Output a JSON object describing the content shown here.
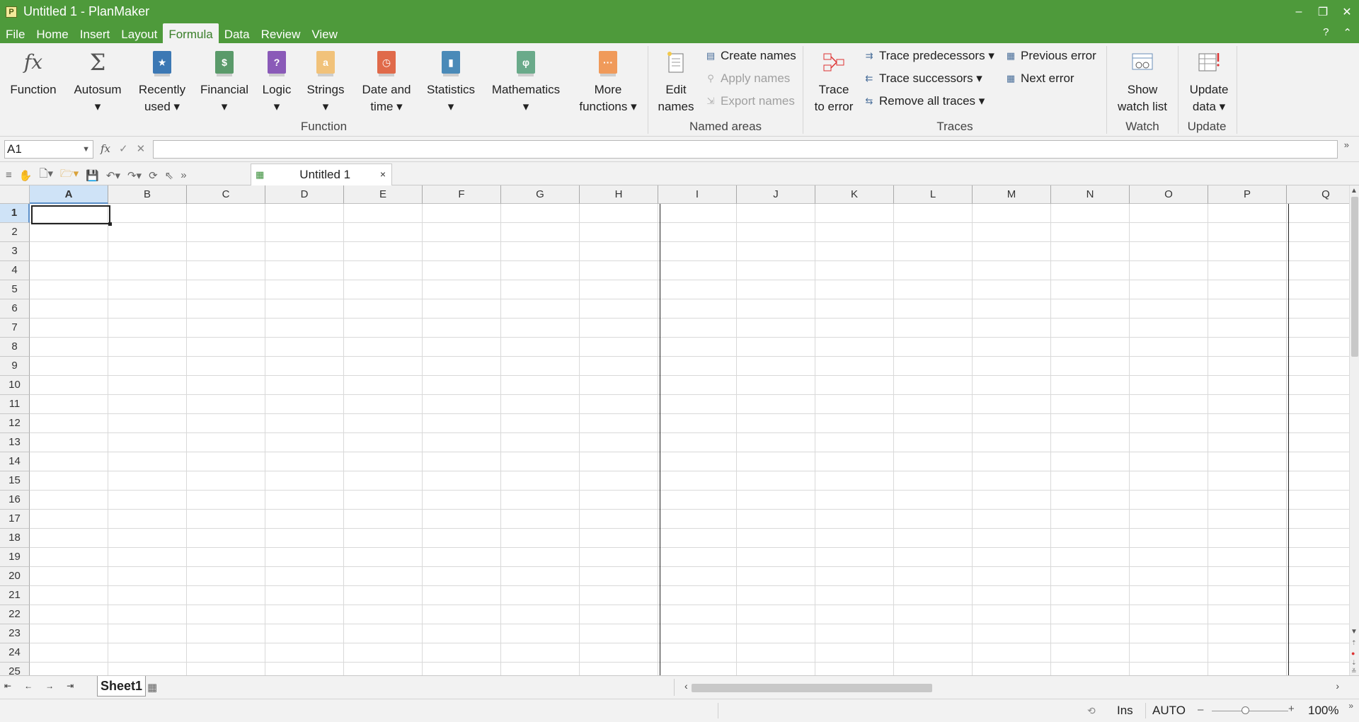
{
  "window": {
    "app_icon_letter": "P",
    "title": "Untitled 1 - PlanMaker",
    "controls": {
      "minimize": "–",
      "restore": "❐",
      "close": "✕"
    }
  },
  "menu": {
    "items": [
      "File",
      "Home",
      "Insert",
      "Layout",
      "Formula",
      "Data",
      "Review",
      "View"
    ],
    "active": "Formula",
    "help": "?",
    "collapse": "⌃"
  },
  "ribbon": {
    "function_group": {
      "label": "Function",
      "buttons": [
        {
          "line1": "Function",
          "line2": "",
          "icon": "fx-icon"
        },
        {
          "line1": "Autosum",
          "line2": "▾",
          "icon": "sigma-icon"
        },
        {
          "line1": "Recently",
          "line2": "used ▾",
          "icon": "star-folder-icon",
          "color": "#3c78b4",
          "glyph": "★"
        },
        {
          "line1": "Financial",
          "line2": "▾",
          "icon": "dollar-folder-icon",
          "color": "#5a9a6a",
          "glyph": "$"
        },
        {
          "line1": "Logic",
          "line2": "▾",
          "icon": "question-folder-icon",
          "color": "#8a5ab8",
          "glyph": "?"
        },
        {
          "line1": "Strings",
          "line2": "▾",
          "icon": "text-folder-icon",
          "color": "#f1c27a",
          "glyph": "a"
        },
        {
          "line1": "Date and",
          "line2": "time ▾",
          "icon": "clock-folder-icon",
          "color": "#e06a4a",
          "glyph": "◷"
        },
        {
          "line1": "Statistics",
          "line2": "▾",
          "icon": "chart-folder-icon",
          "color": "#4a8ab8",
          "glyph": "▮"
        },
        {
          "line1": "Mathematics",
          "line2": "▾",
          "icon": "phi-folder-icon",
          "color": "#6aaa8a",
          "glyph": "φ"
        },
        {
          "line1": "More",
          "line2": "functions ▾",
          "icon": "more-folder-icon",
          "color": "#f09a5a",
          "glyph": "···"
        }
      ]
    },
    "named_areas_group": {
      "label": "Named areas",
      "edit_names": {
        "line1": "Edit",
        "line2": "names"
      },
      "create_names": "Create names",
      "apply_names": "Apply names",
      "export_names": "Export names"
    },
    "traces_group": {
      "label": "Traces",
      "trace_to_error": {
        "line1": "Trace",
        "line2": "to error"
      },
      "trace_predecessors": "Trace predecessors ▾",
      "trace_successors": "Trace successors ▾",
      "remove_all_traces": "Remove all traces ▾",
      "previous_error": "Previous error",
      "next_error": "Next error"
    },
    "watch_group": {
      "label": "Watch",
      "show_watch_list": {
        "line1": "Show",
        "line2": "watch list"
      }
    },
    "update_group": {
      "label": "Update",
      "update_data": {
        "line1": "Update",
        "line2": "data ▾"
      }
    }
  },
  "formula_bar": {
    "name_box": "A1",
    "fx": "fx",
    "confirm": "✓",
    "cancel": "✕",
    "value": "",
    "more": "»"
  },
  "toolbar": {
    "doc_tab_title": "Untitled 1",
    "doc_tab_close": "×"
  },
  "grid": {
    "columns": [
      "A",
      "B",
      "C",
      "D",
      "E",
      "F",
      "G",
      "H",
      "I",
      "J",
      "K",
      "L",
      "M",
      "N",
      "O",
      "P",
      "Q"
    ],
    "rows": [
      "1",
      "2",
      "3",
      "4",
      "5",
      "6",
      "7",
      "8",
      "9",
      "10",
      "11",
      "12",
      "13",
      "14",
      "15",
      "16",
      "17",
      "18",
      "19",
      "20",
      "21",
      "22",
      "23",
      "24",
      "25"
    ],
    "selected_column": "A",
    "selected_row": "1"
  },
  "sheets": {
    "tabs": [
      "Sheet1"
    ],
    "active": "Sheet1"
  },
  "status": {
    "mode": "Ins",
    "calc": "AUTO",
    "zoom": "100%"
  }
}
